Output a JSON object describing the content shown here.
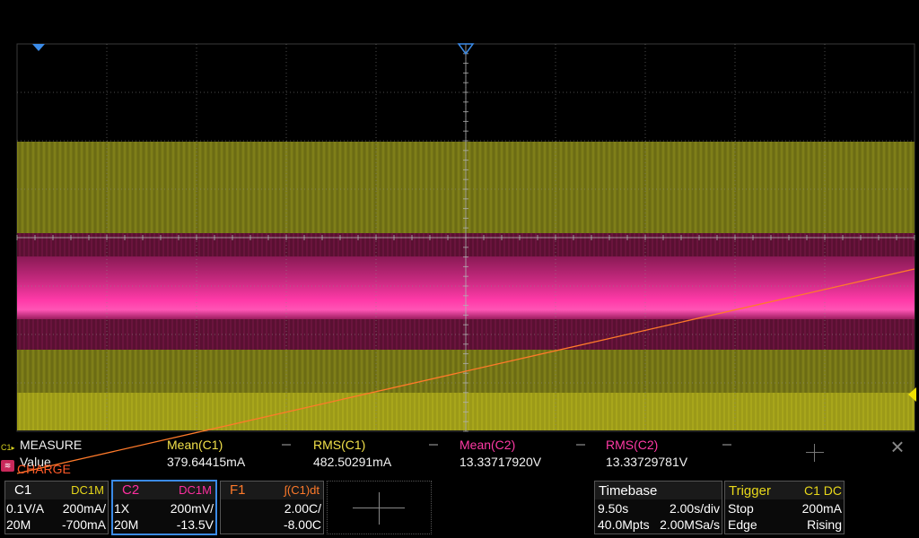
{
  "scope": {
    "colors": {
      "c1": "#d8d21e",
      "c2": "#ff2fa0",
      "f1": "#ff7a2a",
      "grid": "#6a6a6a"
    }
  },
  "markers": {
    "c1_marker_label": "C1",
    "f1_marker_label": "CHARGE",
    "c2_marker_label": "C2"
  },
  "measure": {
    "title": "MEASURE",
    "row_label": "Value",
    "columns": [
      {
        "name": "Mean(C1)",
        "value": "379.64415mA"
      },
      {
        "name": "RMS(C1)",
        "value": "482.50291mA"
      },
      {
        "name": "Mean(C2)",
        "value": "13.33717920V"
      },
      {
        "name": "RMS(C2)",
        "value": "13.33729781V"
      }
    ]
  },
  "c1": {
    "tag": "C1",
    "coupling": "DC1M",
    "r1a": "0.1V/A",
    "r1b": "200mA/",
    "r2a": "20M",
    "r2b": "-700mA"
  },
  "c2": {
    "tag": "C2",
    "coupling": "DC1M",
    "r1a": "1X",
    "r1b": "200mV/",
    "r2a": "20M",
    "r2b": "-13.5V"
  },
  "f1": {
    "tag": "F1",
    "expr": "∫(C1)dt",
    "r1b": "2.00C/",
    "r2b": "-8.00C"
  },
  "timebase": {
    "title": "Timebase",
    "r1a": "9.50s",
    "r1b": "2.00s/div",
    "r2a": "40.0Mpts",
    "r2b": "2.00MSa/s"
  },
  "trigger": {
    "title": "Trigger",
    "source": "C1 DC",
    "r1a": "Stop",
    "r1b": "200mA",
    "r2a": "Edge",
    "r2b": "Rising"
  }
}
